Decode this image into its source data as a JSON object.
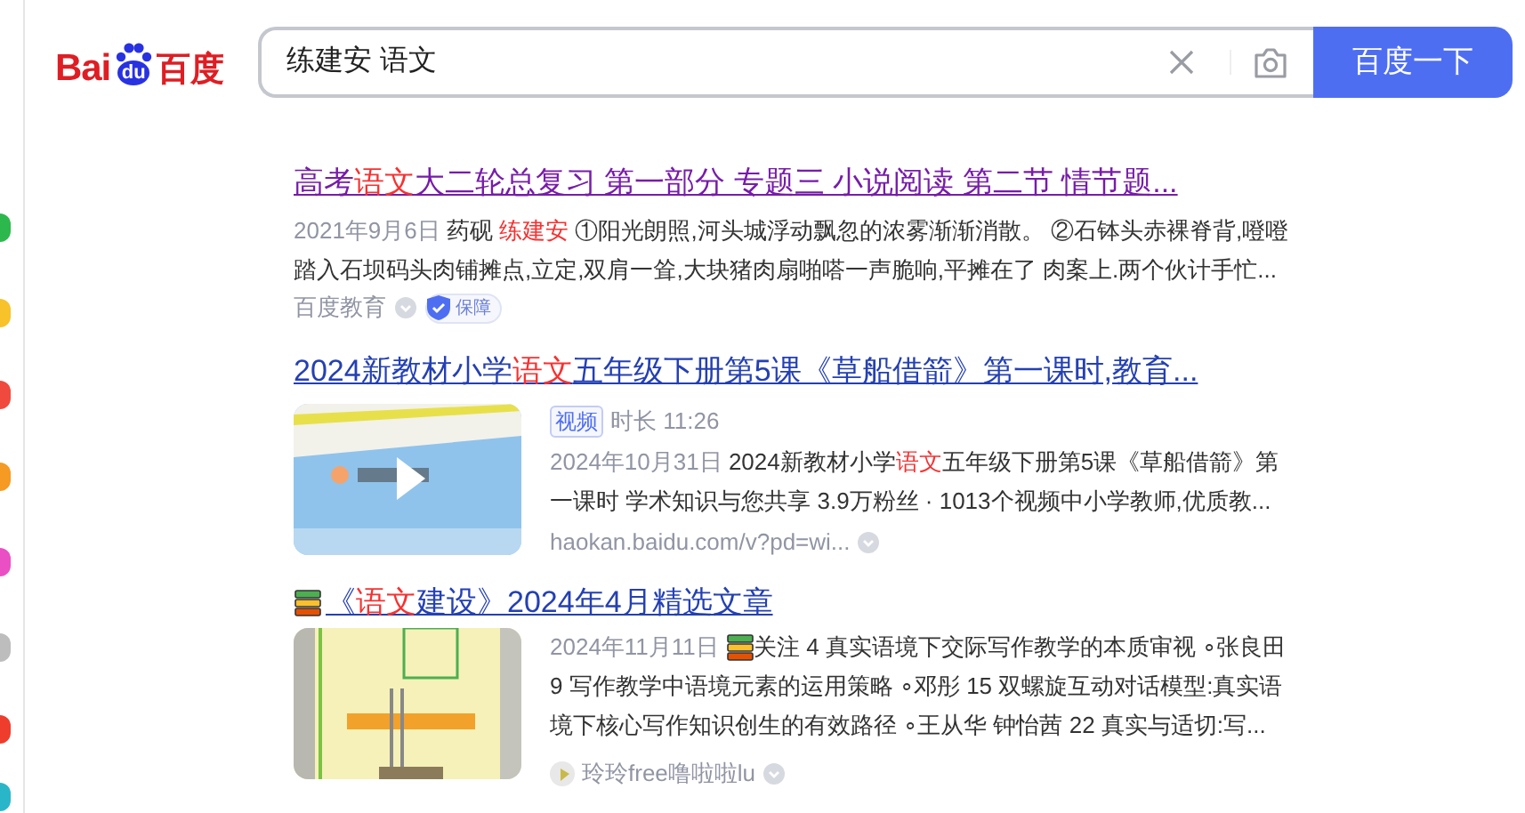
{
  "logo": {
    "left": "Bai",
    "paw": "du",
    "right": "百度"
  },
  "search": {
    "value": "练建安 语文",
    "button": "百度一下"
  },
  "results": [
    {
      "kind": "article",
      "visited": true,
      "title": [
        {
          "text": "高考",
          "highlight": false
        },
        {
          "text": "语文",
          "highlight": true
        },
        {
          "text": "大二轮总复习 第一部分 专题三 小说阅读 第二节 情节题...",
          "highlight": false
        }
      ],
      "lines": [
        [
          {
            "text": "2021年9月6日 ",
            "kind": "date"
          },
          {
            "text": "药砚 ",
            "kind": "plain"
          },
          {
            "text": "练建安",
            "kind": "highlight"
          },
          {
            "text": " ①阳光朗照,河头城浮动飘忽的浓雾渐渐消散。 ②石钵头赤裸脊背,噔噔",
            "kind": "plain"
          }
        ],
        [
          {
            "text": "踏入石坝码头肉铺摊点,立定,双肩一耸,大块猪肉扇啪嗒一声脆响,平摊在了 肉案上.两个伙计手忙...",
            "kind": "plain"
          }
        ]
      ],
      "source": "百度教育",
      "badge": "保障"
    },
    {
      "kind": "video",
      "visited": false,
      "title": [
        {
          "text": "2024新教材小学",
          "highlight": false
        },
        {
          "text": "语文",
          "highlight": true
        },
        {
          "text": "五年级下册第5课《草船借箭》第一课时,教育...",
          "highlight": false
        }
      ],
      "tag": "视频",
      "duration": "时长 11:26",
      "lines": [
        [
          {
            "text": "2024年10月31日 ",
            "kind": "date"
          },
          {
            "text": "2024新教材小学",
            "kind": "plain"
          },
          {
            "text": "语文",
            "kind": "highlight"
          },
          {
            "text": "五年级下册第5课《草船借箭》第",
            "kind": "plain"
          }
        ],
        [
          {
            "text": "一课时 学术知识与您共享 3.9万粉丝 · 1013个视频中小学教师,优质教...",
            "kind": "plain"
          }
        ]
      ],
      "source": "haokan.baidu.com/v?pd=wi..."
    },
    {
      "kind": "magazine",
      "visited": false,
      "title": [
        {
          "text": "《",
          "highlight": false
        },
        {
          "text": "语文",
          "highlight": true
        },
        {
          "text": "建设》2024年4月精选文章",
          "highlight": false
        }
      ],
      "lines": [
        [
          {
            "text": "2024年11月11日 ",
            "kind": "date"
          },
          {
            "text": "关注 4 真实语境下交际写作教学的本质审视 ∘张良田",
            "kind": "plain"
          }
        ],
        [
          {
            "text": "9 写作教学中语境元素的运用策略 ∘邓彤 15 双螺旋互动对话模型:真实语",
            "kind": "plain"
          }
        ],
        [
          {
            "text": "境下核心写作知识创生的有效路径 ∘王从华 钟怡茜 22 真实与适切:写...",
            "kind": "plain"
          }
        ]
      ],
      "source": "玲玲free噜啦啦lu"
    }
  ]
}
